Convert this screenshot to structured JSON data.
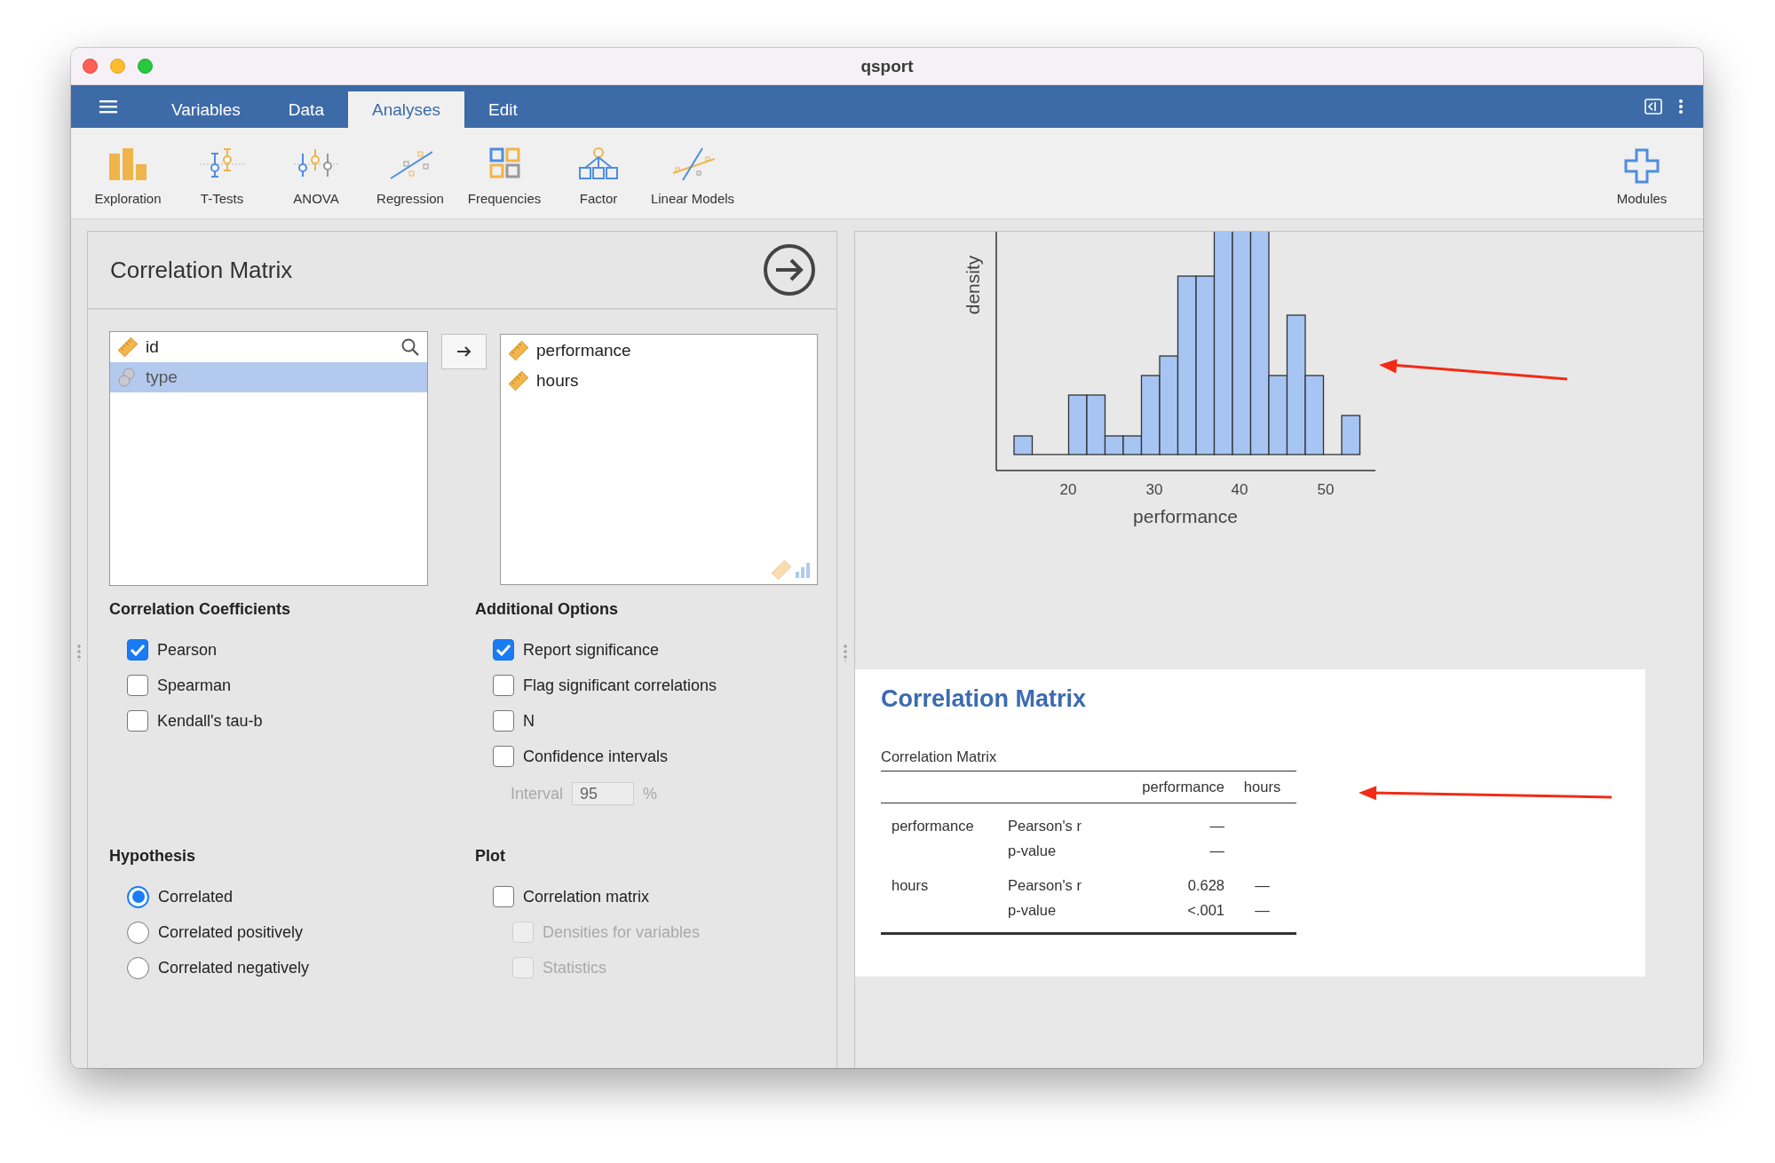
{
  "window": {
    "title": "qsport"
  },
  "menu_bar": {
    "tabs": [
      {
        "label": "Variables",
        "selected": false
      },
      {
        "label": "Data",
        "selected": false
      },
      {
        "label": "Analyses",
        "selected": true
      },
      {
        "label": "Edit",
        "selected": false
      }
    ]
  },
  "toolbar": {
    "items": [
      {
        "label": "Exploration",
        "kind": "exploration"
      },
      {
        "label": "T-Tests",
        "kind": "ttests"
      },
      {
        "label": "ANOVA",
        "kind": "anova"
      },
      {
        "label": "Regression",
        "kind": "regression"
      },
      {
        "label": "Frequencies",
        "kind": "frequencies"
      },
      {
        "label": "Factor",
        "kind": "factor"
      },
      {
        "label": "Linear Models",
        "kind": "linear"
      },
      {
        "label": "Modules",
        "kind": "modules"
      }
    ]
  },
  "options_panel": {
    "title": "Correlation Matrix",
    "available_variables": [
      {
        "name": "id",
        "kind": "continuous",
        "selected": false
      },
      {
        "name": "type",
        "kind": "nominal",
        "selected": true
      }
    ],
    "selected_variables": [
      {
        "name": "performance",
        "kind": "continuous"
      },
      {
        "name": "hours",
        "kind": "continuous"
      }
    ],
    "sections": [
      {
        "title": "Correlation Coefficients",
        "items": [
          {
            "kind": "checkbox",
            "label": "Pearson",
            "checked": true
          },
          {
            "kind": "checkbox",
            "label": "Spearman",
            "checked": false
          },
          {
            "kind": "checkbox",
            "label": "Kendall's tau-b",
            "checked": false
          }
        ]
      },
      {
        "title": "Additional Options",
        "items": [
          {
            "kind": "checkbox",
            "label": "Report significance",
            "checked": true
          },
          {
            "kind": "checkbox",
            "label": "Flag significant correlations",
            "checked": false
          },
          {
            "kind": "checkbox",
            "label": "N",
            "checked": false
          },
          {
            "kind": "checkbox",
            "label": "Confidence intervals",
            "checked": false,
            "children": [
              {
                "kind": "number_field",
                "label": "Interval",
                "value": "95",
                "suffix": "%",
                "disabled": true
              }
            ]
          }
        ]
      },
      {
        "title": "Hypothesis",
        "items": [
          {
            "kind": "radio",
            "label": "Correlated",
            "selected": true
          },
          {
            "kind": "radio",
            "label": "Correlated positively",
            "selected": false
          },
          {
            "kind": "radio",
            "label": "Correlated negatively",
            "selected": false
          }
        ]
      },
      {
        "title": "Plot",
        "items": [
          {
            "kind": "checkbox",
            "label": "Correlation matrix",
            "checked": false,
            "children": [
              {
                "kind": "checkbox",
                "label": "Densities for variables",
                "checked": false,
                "disabled": true
              },
              {
                "kind": "checkbox",
                "label": "Statistics",
                "checked": false,
                "disabled": true
              }
            ]
          }
        ]
      }
    ]
  },
  "results": {
    "plot": {
      "xlabel": "performance",
      "ylabel": "density",
      "xticks": [
        "20",
        "30",
        "40",
        "50"
      ]
    },
    "title": "Correlation Matrix",
    "table": {
      "caption": "Correlation Matrix",
      "columns": [
        "performance",
        "hours"
      ],
      "rows": [
        {
          "variable": "performance",
          "stats": [
            {
              "label": "Pearson's r",
              "values": [
                "—"
              ]
            },
            {
              "label": "p-value",
              "values": [
                "—"
              ]
            }
          ]
        },
        {
          "variable": "hours",
          "stats": [
            {
              "label": "Pearson's r",
              "values": [
                "0.628",
                "—"
              ]
            },
            {
              "label": "p-value",
              "values": [
                "<.001",
                "—"
              ]
            }
          ]
        }
      ]
    }
  }
}
